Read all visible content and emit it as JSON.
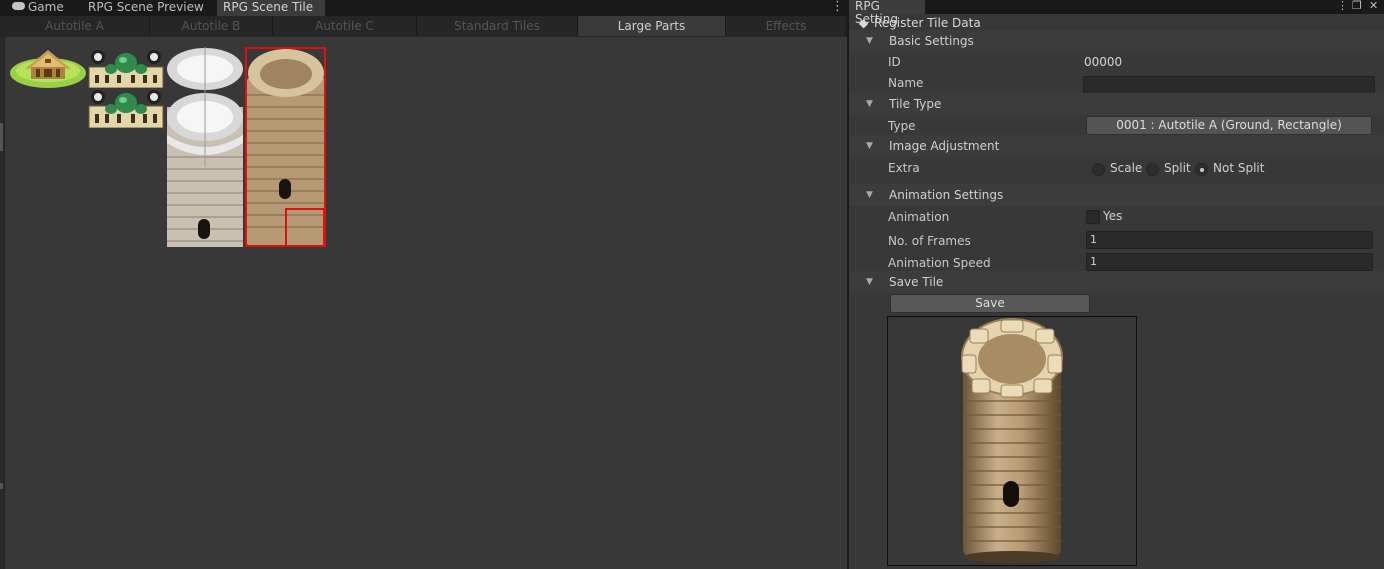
{
  "window_tabs": [
    {
      "label": "Game",
      "icon": "gamepad-icon",
      "active": false
    },
    {
      "label": "RPG Scene Preview",
      "active": false
    },
    {
      "label": "RPG Scene Tile",
      "active": true
    }
  ],
  "sub_tabs": [
    {
      "label": "Autotile A",
      "active": false
    },
    {
      "label": "Autotile B",
      "active": false
    },
    {
      "label": "Autotile C",
      "active": false
    },
    {
      "label": "Standard Tiles",
      "active": false
    },
    {
      "label": "Large Parts",
      "active": true
    },
    {
      "label": "Effects",
      "active": false
    }
  ],
  "palette": {
    "tiles": [
      {
        "name": "tent-tile"
      },
      {
        "name": "palace-tile-top"
      },
      {
        "name": "palace-tile-bottom"
      },
      {
        "name": "snow-tower-tile"
      },
      {
        "name": "stone-tower-tile",
        "selected": true
      }
    ],
    "selection_color": "#e01010"
  },
  "inspector": {
    "tab_title": "RPG Setting",
    "section_title": "Register Tile Data",
    "basic_settings": {
      "header": "Basic Settings",
      "id_label": "ID",
      "id_value": "00000",
      "name_label": "Name",
      "name_value": ""
    },
    "tile_type": {
      "header": "Tile Type",
      "type_label": "Type",
      "type_value": "0001 : Autotile A (Ground, Rectangle)"
    },
    "image_adjustment": {
      "header": "Image Adjustment",
      "extra_label": "Extra",
      "options": [
        {
          "label": "Scale",
          "selected": false
        },
        {
          "label": "Split",
          "selected": false
        },
        {
          "label": "Not Split",
          "selected": true
        }
      ]
    },
    "animation_settings": {
      "header": "Animation Settings",
      "animation_label": "Animation",
      "animation_checkbox_label": "Yes",
      "animation_checked": false,
      "frames_label": "No. of Frames",
      "frames_value": "1",
      "speed_label": "Animation Speed",
      "speed_value": "1"
    },
    "save_tile": {
      "header": "Save Tile",
      "save_label": "Save"
    }
  },
  "colors": {
    "panel": "#383838",
    "header": "#3c3c3c",
    "field": "#2a2a2a",
    "button": "#585858",
    "highlight": "#e01010"
  }
}
